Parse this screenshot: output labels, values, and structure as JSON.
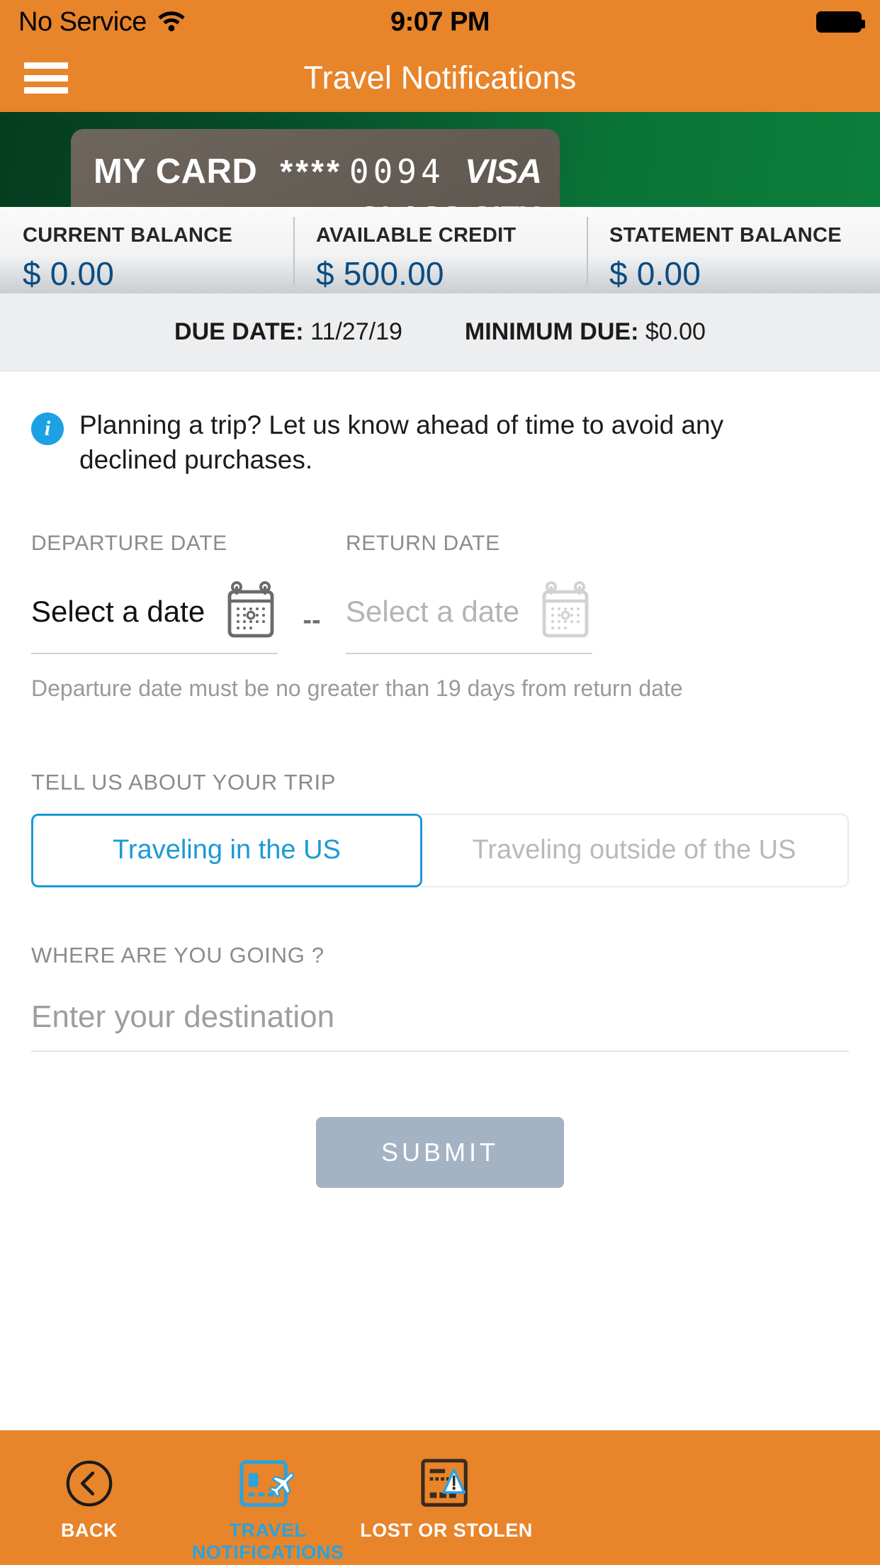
{
  "status_bar": {
    "carrier": "No Service",
    "time": "9:07 PM",
    "wifi_icon": "wifi-icon",
    "battery_icon": "battery-full-icon"
  },
  "header": {
    "title": "Travel Notifications",
    "menu_icon": "hamburger-menu-icon",
    "background_color": "#E8842A"
  },
  "card": {
    "name": "MY CARD",
    "mask": "****",
    "last_four": "0094",
    "network": "VISA",
    "bank_name": "GLASS CITY",
    "card_color": "#665F57",
    "band_color": "#0A7436"
  },
  "balances": [
    {
      "label": "CURRENT BALANCE",
      "value": "$ 0.00"
    },
    {
      "label": "AVAILABLE CREDIT",
      "value": "$ 500.00"
    },
    {
      "label": "STATEMENT BALANCE",
      "value": "$ 0.00"
    }
  ],
  "balance_value_color": "#0B4C82",
  "due": {
    "due_date_label": "DUE DATE:",
    "due_date_value": "11/27/19",
    "minimum_due_label": "MINIMUM DUE:",
    "minimum_due_value": "$0.00"
  },
  "info_banner": {
    "icon": "info-circle-icon",
    "icon_color": "#1CA2E3",
    "text": "Planning a trip? Let us know ahead of time to avoid any declined purchases."
  },
  "dates": {
    "departure_label": "DEPARTURE DATE",
    "departure_value": "Select a date",
    "separator": "--",
    "return_label": "RETURN DATE",
    "return_value": "Select a date",
    "calendar_icon": "calendar-icon",
    "note": "Departure date must be no greater than 19 days from return date"
  },
  "trip_type": {
    "label": "TELL US ABOUT YOUR TRIP",
    "options": [
      {
        "label": "Traveling in the US",
        "selected": true
      },
      {
        "label": "Traveling outside of the US",
        "selected": false
      }
    ],
    "selected_color": "#1B9AD6"
  },
  "destination": {
    "label": "WHERE ARE YOU GOING ?",
    "value": "",
    "placeholder": "Enter your destination"
  },
  "submit": {
    "label": "SUBMIT",
    "enabled": false,
    "color": "#A3B3C4"
  },
  "bottom_nav": {
    "background_color": "#E8842A",
    "active_color": "#2AA3DF",
    "items": [
      {
        "label": "BACK",
        "icon": "back-circle-chevron-icon",
        "active": false
      },
      {
        "label": "TRAVEL\nNOTIFICATIONS",
        "label_line1": "TRAVEL",
        "label_line2": "NOTIFICATIONS",
        "icon": "card-airplane-icon",
        "active": true
      },
      {
        "label": "LOST OR STOLEN",
        "icon": "card-warning-icon",
        "active": false
      }
    ]
  }
}
